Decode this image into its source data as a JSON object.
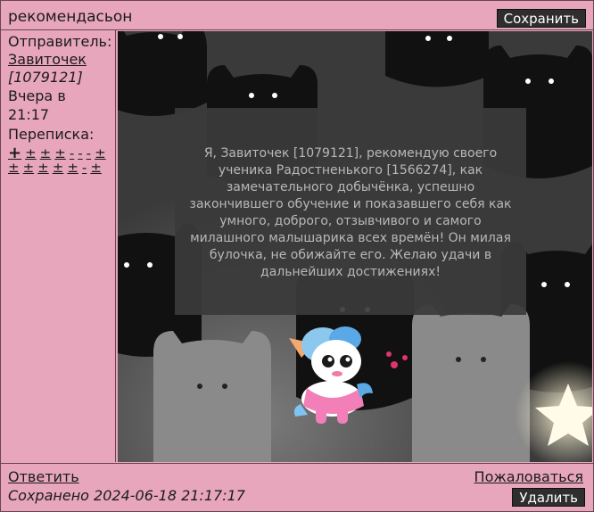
{
  "header": {
    "title": "рекомендасьон",
    "save_label": "Сохранить"
  },
  "sidebar": {
    "sender_label": "Отправитель:",
    "sender_name": "Завиточек",
    "sender_id": "[1079121]",
    "date_line1": "Вчера в",
    "date_line2": "21:17",
    "correspondence_label": "Переписка:",
    "correspondence_marks": [
      "+",
      "±",
      "±",
      "±",
      "-",
      "-",
      "-",
      "±",
      "±",
      "±",
      "±",
      "±",
      "±",
      "-",
      "±"
    ]
  },
  "message": {
    "text": "Я, Завиточек [1079121], рекомендую своего ученика Радостненького [1566274], как замечательного добычёнка, успешно закончившего обучение и показавшего себя как умного, доброго, отзывчивого и самого милашного малышарика всех времён! Он милая булочка, не обижайте его. Желаю удачи в дальнейших достижениях!"
  },
  "footer": {
    "reply_label": "Ответить",
    "complain_label": "Пожаловаться",
    "saved_text": "Сохранено 2024-06-18 21:17:17",
    "delete_label": "Удалить"
  },
  "colors": {
    "page_background": "#e7a6bb",
    "button_background": "#2f2e2e",
    "message_box": "#3a3a3a",
    "message_text": "#b8b8b8"
  },
  "icons": [
    "cat-silhouette-pattern",
    "unicorn-character",
    "glowing-star"
  ]
}
